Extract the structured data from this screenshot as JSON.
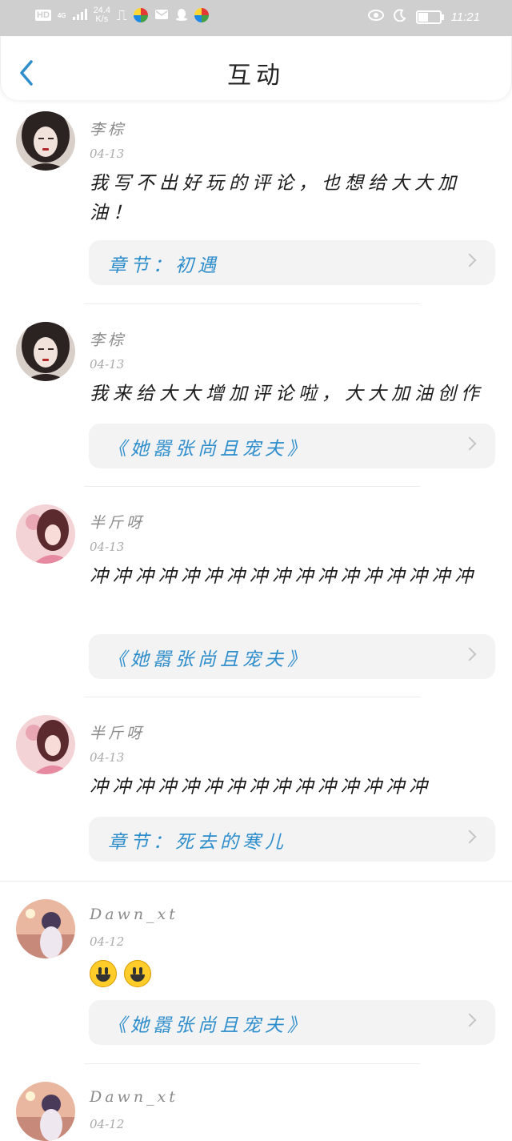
{
  "status_bar": {
    "left_badge": "HD",
    "network": "4G",
    "speed_value": "24.4",
    "speed_unit": "K/s",
    "time": "11:21"
  },
  "header": {
    "title": "互动",
    "back_icon": "chevron-left-icon"
  },
  "items": [
    {
      "name": "李棕",
      "date": "04-13",
      "comment": "我写不出好玩的评论，也想给大大加油！",
      "ref": "章节：初遇",
      "avatar": "dark-hair-girl"
    },
    {
      "name": "李棕",
      "date": "04-13",
      "comment": "我来给大大增加评论啦，大大加油创作",
      "ref": "《她嚣张尚且宠夫》",
      "avatar": "dark-hair-girl"
    },
    {
      "name": "半斤呀",
      "date": "04-13",
      "comment": "冲冲冲冲冲冲冲冲冲冲冲冲冲冲冲冲冲",
      "ref": "《她嚣张尚且宠夫》",
      "avatar": "pink-anime-girl"
    },
    {
      "name": "半斤呀",
      "date": "04-13",
      "comment": "冲冲冲冲冲冲冲冲冲冲冲冲冲冲冲",
      "ref": "章节：死去的寒儿",
      "avatar": "pink-anime-girl"
    },
    {
      "name": "Dawn_xt",
      "date": "04-12",
      "comment": "",
      "emoji_count": 2,
      "ref": "《她嚣张尚且宠夫》",
      "avatar": "sunset-girl"
    },
    {
      "name": "Dawn_xt",
      "date": "04-12",
      "avatar": "sunset-girl"
    }
  ],
  "colors": {
    "status_bar": "#cfcfcf",
    "accent": "#2e8ecc",
    "ref_bg": "#f3f3f3"
  }
}
